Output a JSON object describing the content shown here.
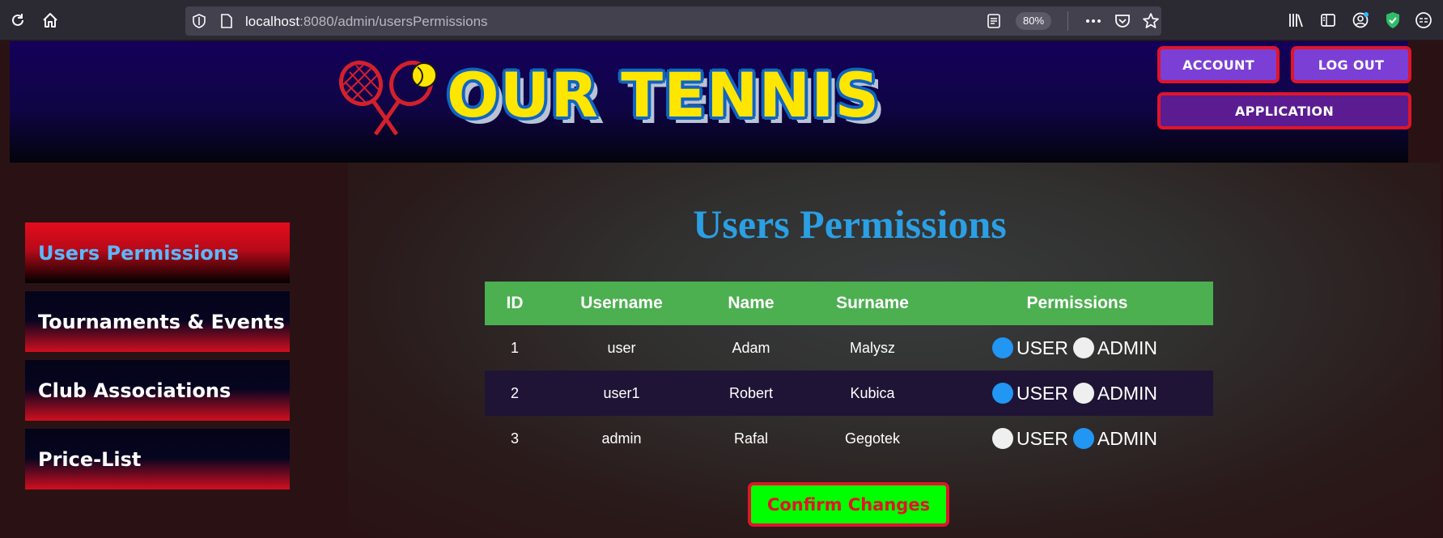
{
  "browser": {
    "url_host": "localhost",
    "url_path": ":8080/admin/usersPermissions",
    "zoom": "80%"
  },
  "header": {
    "logo_text": "OUR TENNIS",
    "account_label": "ACCOUNT",
    "logout_label": "LOG OUT",
    "application_label": "APPLICATION"
  },
  "sidebar": {
    "items": [
      {
        "label": "Users Permissions",
        "active": true
      },
      {
        "label": "Tournaments & Events"
      },
      {
        "label": "Club Associations"
      },
      {
        "label": "Price-List"
      }
    ]
  },
  "main": {
    "title": "Users Permissions",
    "columns": [
      "ID",
      "Username",
      "Name",
      "Surname",
      "Permissions"
    ],
    "rows": [
      {
        "id": "1",
        "username": "user",
        "name": "Adam",
        "surname": "Malysz",
        "permission": "USER"
      },
      {
        "id": "2",
        "username": "user1",
        "name": "Robert",
        "surname": "Kubica",
        "permission": "USER"
      },
      {
        "id": "3",
        "username": "admin",
        "name": "Rafal",
        "surname": "Gegotek",
        "permission": "ADMIN"
      }
    ],
    "permission_options": [
      "USER",
      "ADMIN"
    ],
    "confirm_label": "Confirm Changes"
  },
  "colors": {
    "table_header": "#4caf50",
    "radio_checked": "#2196f3",
    "title": "#2b9fe3",
    "button_border": "#e1142a",
    "confirm_bg": "#00ff00",
    "logo_yellow": "#ffe600"
  }
}
